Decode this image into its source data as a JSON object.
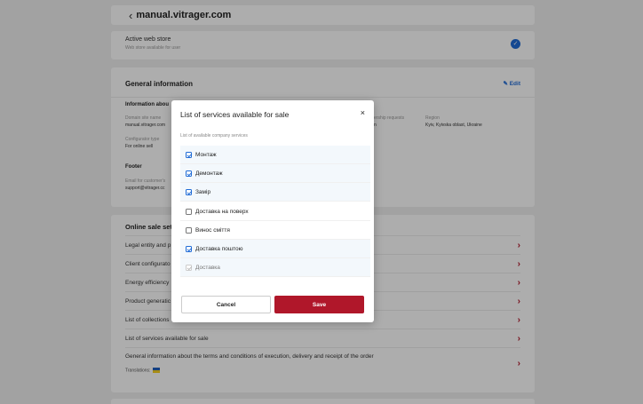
{
  "topbar": {
    "back_glyph": "‹",
    "domain": "manual.vitrager.com"
  },
  "active_store": {
    "title": "Active web store",
    "subtitle": "Web store available for user",
    "toggle_glyph": "✓"
  },
  "general": {
    "heading": "General information",
    "edit_label": "Edit",
    "info_heading": "Information abou",
    "domain_label": "Domain site name",
    "domain_value": "manual.vitrager.com",
    "configurator_label": "Configurator type",
    "configurator_value": "For online sell",
    "requests_label": "ership requests",
    "requests_value": "n",
    "region_label": "Region",
    "region_value": "Kyiv, Kyivska oblast, Ukraine",
    "footer_heading": "Footer",
    "email_label": "Email for customer's",
    "email_value": "support@vitrager.cc"
  },
  "online": {
    "heading": "Online sale settir",
    "rows": [
      {
        "label": "Legal entity and p"
      },
      {
        "label": "Client configurato"
      },
      {
        "label": "Energy efficiency"
      },
      {
        "label": "Product generatic"
      },
      {
        "label": "List of collections"
      },
      {
        "label": "List of services available for sale"
      }
    ],
    "terms_label": "General information about the terms and conditions of execution, delivery and receipt of the order",
    "translations_label": "Translations:",
    "chevron_glyph": "›"
  },
  "modal": {
    "title": "List of services available for sale",
    "close_glyph": "×",
    "description": "List of available company services",
    "services": [
      {
        "label": "Монтаж",
        "checked": true
      },
      {
        "label": "Демонтаж",
        "checked": true
      },
      {
        "label": "Замір",
        "checked": true
      },
      {
        "label": "Доставка на поверх",
        "checked": false
      },
      {
        "label": "Винос сміття",
        "checked": false
      },
      {
        "label": "Доставка поштою",
        "checked": true
      },
      {
        "label": "Доставка",
        "checked": true,
        "disabled": true
      }
    ],
    "cancel_label": "Cancel",
    "save_label": "Save"
  },
  "colors": {
    "accent": "#1f6bd6",
    "brand": "#b0172a",
    "overlay": "rgba(0,0,0,0.32)"
  }
}
